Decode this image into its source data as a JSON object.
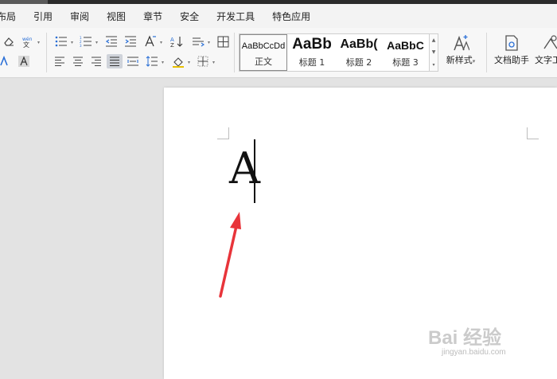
{
  "menu": [
    "布局",
    "引用",
    "审阅",
    "视图",
    "章节",
    "安全",
    "开发工具",
    "特色应用"
  ],
  "styles": [
    {
      "sample": "AaBbCcDd",
      "label": "正文"
    },
    {
      "sample": "AaBb",
      "label": "标题 1"
    },
    {
      "sample": "AaBb(",
      "label": "标题 2"
    },
    {
      "sample": "AaBbC",
      "label": "标题 3"
    }
  ],
  "new_style_label": "新样式",
  "doc_assistant_label": "文档助手",
  "text_tools_label": "文字工",
  "document": {
    "typed_text": "A"
  },
  "watermark": {
    "text": "Bai 经验",
    "sub": "jingyan.baidu.com"
  },
  "colors": {
    "arrow": "#e8343a",
    "selected_style_border": "#8a8a8a",
    "ribbon_bg": "#f7f7f7"
  }
}
